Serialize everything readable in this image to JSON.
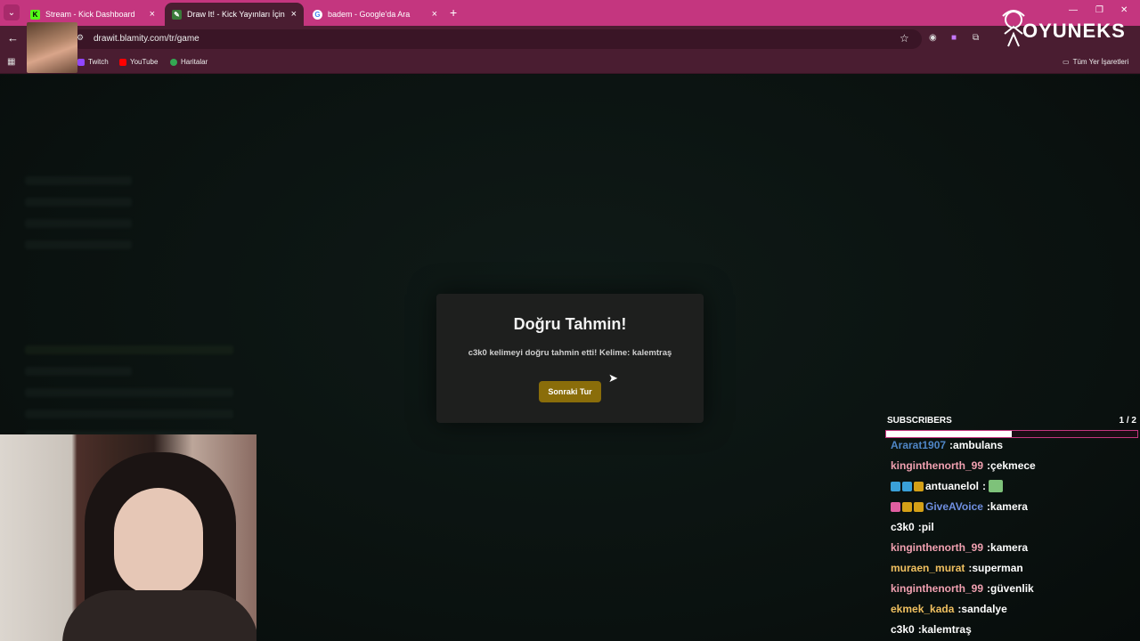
{
  "browser": {
    "tabs": [
      {
        "title": "Stream - Kick Dashboard",
        "favicon": "kick-icon",
        "active": false
      },
      {
        "title": "Draw It! - Kick Yayınları İçin Çizi",
        "favicon": "drawit-icon",
        "active": true
      },
      {
        "title": "badem - Google'da Ara",
        "favicon": "google-icon",
        "active": false
      }
    ],
    "new_tab_label": "+",
    "url": "drawit.blamity.com/tr/game",
    "bookmarks": [
      {
        "label": "Twitch",
        "color": "#9146ff"
      },
      {
        "label": "YouTube",
        "color": "#ff0000"
      },
      {
        "label": "Haritalar",
        "color": "#34a853"
      }
    ],
    "all_bookmarks_label": "Tüm Yer İşaretleri",
    "accent_color": "#c4367f"
  },
  "logo": {
    "text": "OYUNEKS"
  },
  "modal": {
    "title": "Doğru Tahmin!",
    "message": "c3k0 kelimeyi doğru tahmin etti! Kelime: kalemtraş",
    "next_button": "Sonraki Tur"
  },
  "subscribers": {
    "label": "SUBSCRIBERS",
    "count": "1  / 2",
    "progress_fraction": 0.5
  },
  "chat": [
    {
      "user": "Ararat1907",
      "color": "#4f86c6",
      "text": "ambulans",
      "badges": []
    },
    {
      "user": "kinginthenorth_99",
      "color": "#f0a0b0",
      "text": "çekmece",
      "badges": []
    },
    {
      "user": "antuanelol",
      "color": "#ffffff",
      "text": "",
      "badges": [
        "#3aa0d8",
        "#3aa0d8",
        "#d4a017"
      ],
      "emote": true
    },
    {
      "user": "GiveAVoice",
      "color": "#6f8fe0",
      "text": "kamera",
      "badges": [
        "#e05fa0",
        "#d4a017",
        "#d4a017"
      ]
    },
    {
      "user": "c3k0",
      "color": "#ffffff",
      "text": "pil",
      "badges": []
    },
    {
      "user": "kinginthenorth_99",
      "color": "#f0a0b0",
      "text": "kamera",
      "badges": []
    },
    {
      "user": "muraen_murat",
      "color": "#f0c060",
      "text": "superman",
      "badges": []
    },
    {
      "user": "kinginthenorth_99",
      "color": "#f0a0b0",
      "text": "güvenlik",
      "badges": []
    },
    {
      "user": "ekmek_kada",
      "color": "#f0c060",
      "text": "sandalye",
      "badges": []
    },
    {
      "user": "c3k0",
      "color": "#ffffff",
      "text": "kalemtraş",
      "badges": []
    }
  ]
}
